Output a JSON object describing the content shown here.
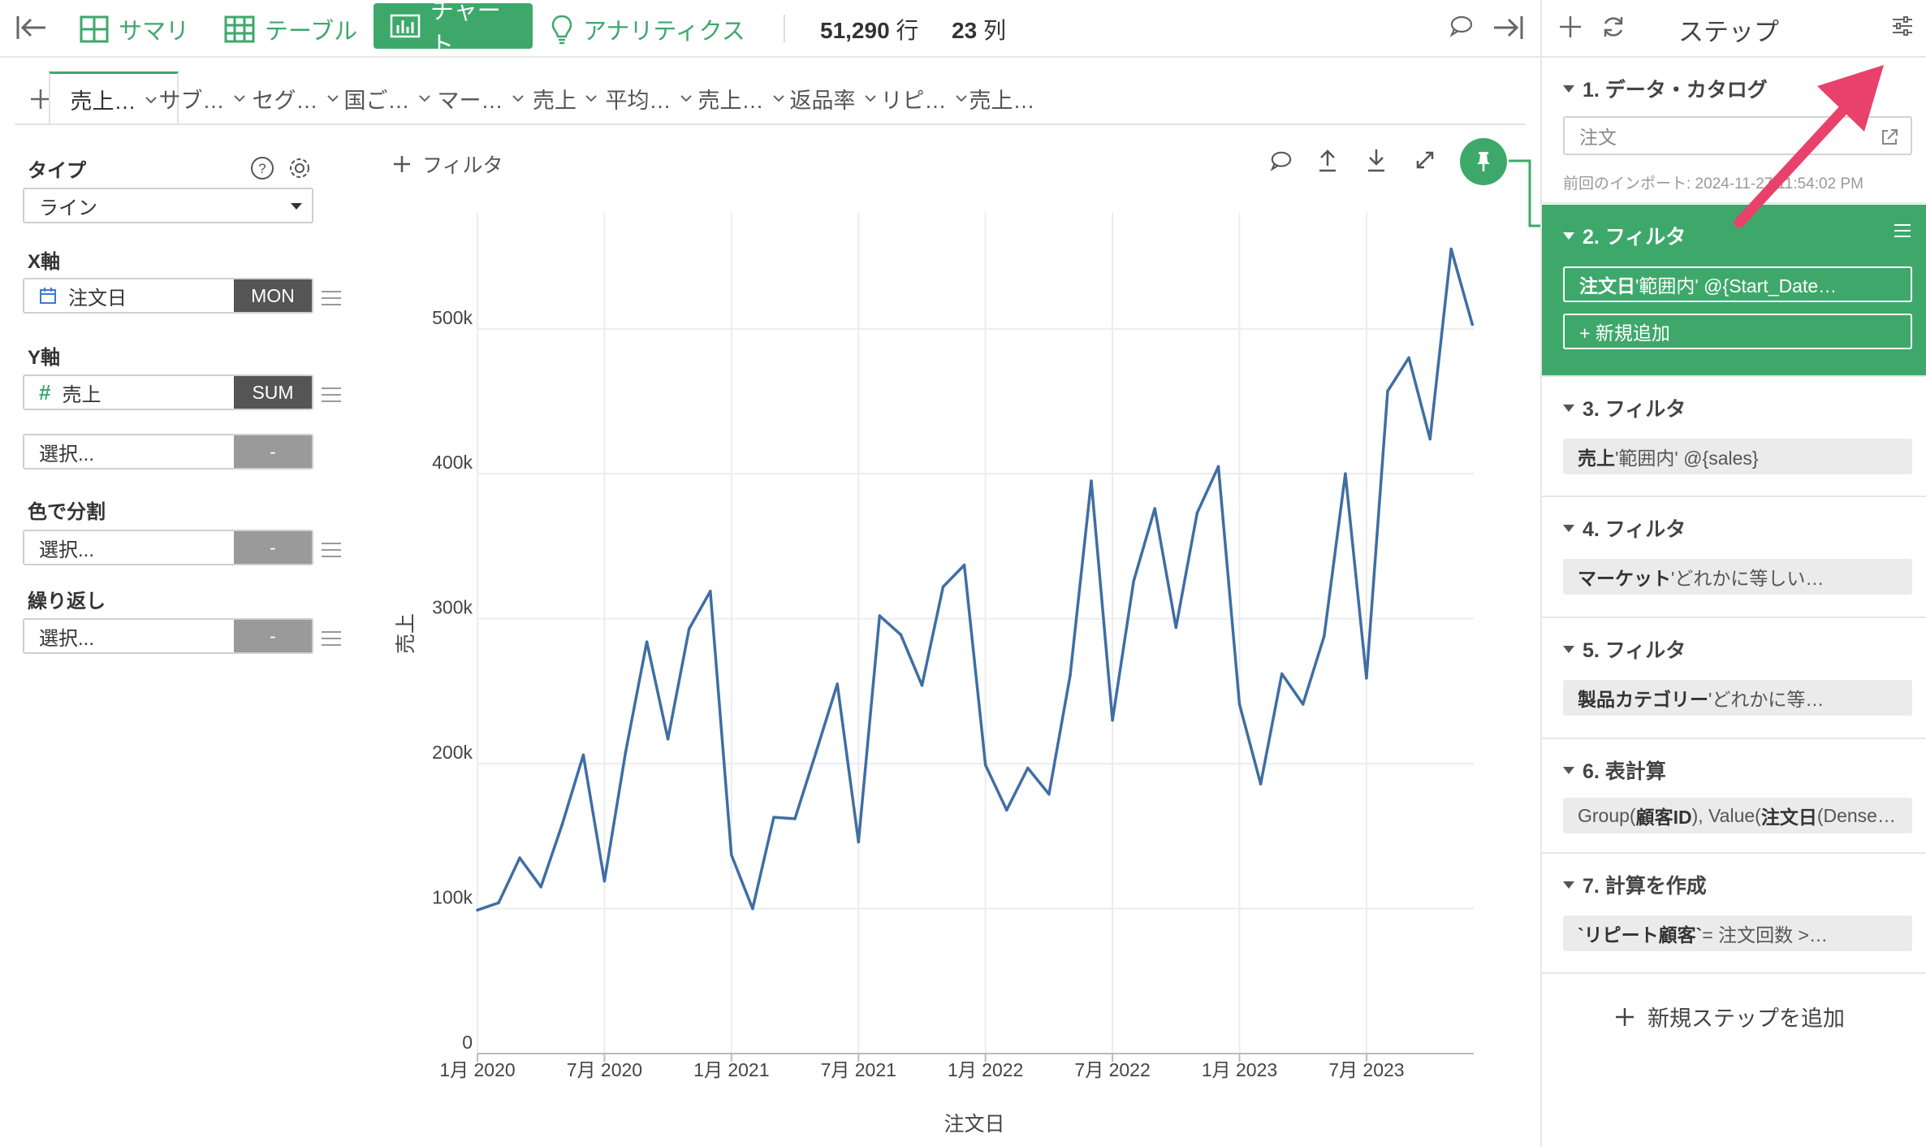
{
  "toolbar": {
    "summary": "サマリ",
    "table": "テーブル",
    "chart": "チャート",
    "analytics": "アナリティクス",
    "rows_value": "51,290",
    "rows_unit": "行",
    "cols_value": "23",
    "cols_unit": "列"
  },
  "tabs": [
    "売上…",
    "サブ…",
    "セグ…",
    "国ご…",
    "マー…",
    "売上",
    "平均…",
    "売上…",
    "返品率",
    "リピ…",
    "売上…"
  ],
  "config": {
    "type_label": "タイプ",
    "type_value": "ライン",
    "x_label": "X軸",
    "x_field": "注文日",
    "x_agg": "MON",
    "y_label": "Y軸",
    "y_field": "売上",
    "y_agg": "SUM",
    "y2_placeholder": "選択...",
    "empty_agg": "-",
    "color_label": "色で分割",
    "color_placeholder": "選択...",
    "repeat_label": "繰り返し",
    "repeat_placeholder": "選択..."
  },
  "chart_toolbar": {
    "filter_label": "フィルタ"
  },
  "chart_data": {
    "type": "line",
    "xlabel": "注文日",
    "ylabel": "売上",
    "ylim": [
      0,
      580000
    ],
    "y_ticks": [
      "0",
      "100k",
      "200k",
      "300k",
      "400k",
      "500k"
    ],
    "y_tick_values": [
      0,
      100000,
      200000,
      300000,
      400000,
      500000
    ],
    "x_ticks": [
      "1月 2020",
      "7月 2020",
      "1月 2021",
      "7月 2021",
      "1月 2022",
      "7月 2022",
      "1月 2023",
      "7月 2023"
    ],
    "series": [
      {
        "color": "#3f6ea3",
        "x": [
          "2020-01",
          "2020-02",
          "2020-03",
          "2020-04",
          "2020-05",
          "2020-06",
          "2020-07",
          "2020-08",
          "2020-09",
          "2020-10",
          "2020-11",
          "2020-12",
          "2021-01",
          "2021-02",
          "2021-03",
          "2021-04",
          "2021-05",
          "2021-06",
          "2021-07",
          "2021-08",
          "2021-09",
          "2021-10",
          "2021-11",
          "2021-12",
          "2022-01",
          "2022-02",
          "2022-03",
          "2022-04",
          "2022-05",
          "2022-06",
          "2022-07",
          "2022-08",
          "2022-09",
          "2022-10",
          "2022-11",
          "2022-12",
          "2023-01",
          "2023-02",
          "2023-03",
          "2023-04",
          "2023-05",
          "2023-06",
          "2023-07",
          "2023-08",
          "2023-09",
          "2023-10",
          "2023-11",
          "2023-12"
        ],
        "values": [
          99000,
          104000,
          135000,
          115000,
          158000,
          206000,
          119000,
          208000,
          284000,
          217000,
          293000,
          319000,
          137000,
          100000,
          163000,
          162000,
          208000,
          255000,
          146000,
          302000,
          289000,
          254000,
          322000,
          337000,
          199000,
          168000,
          197000,
          179000,
          261000,
          395000,
          230000,
          326000,
          376000,
          294000,
          373000,
          405000,
          241000,
          186000,
          262000,
          241000,
          288000,
          400000,
          259000,
          457000,
          480000,
          424000,
          555000,
          503000
        ]
      }
    ]
  },
  "steps": {
    "header_title": "ステップ",
    "items": [
      {
        "title": "1. データ・カタログ",
        "input_value": "注文",
        "note": "前回のインポート: 2024-11-27 11:54:02 PM"
      },
      {
        "title": "2. フィルタ",
        "chip_bold": "注文日",
        "chip_rest": " '範囲内' @{Start_Date…",
        "add_label": "+ 新規追加"
      },
      {
        "title": "3. フィルタ",
        "chip_bold": "売上",
        "chip_rest": " '範囲内' @{sales}"
      },
      {
        "title": "4. フィルタ",
        "chip_bold": "マーケット",
        "chip_rest": " 'どれかに等しい…"
      },
      {
        "title": "5. フィルタ",
        "chip_bold": "製品カテゴリー",
        "chip_rest": " 'どれかに等…"
      },
      {
        "title": "6. 表計算",
        "chip_pre": "Group(",
        "chip_bold": "顧客ID",
        "chip_mid": "), Value(",
        "chip_bold2": "注文日",
        "chip_rest": " (Dense…"
      },
      {
        "title": "7. 計算を作成",
        "chip_bold": "`リピート顧客`",
        "chip_rest": " = 注文回数 >…"
      }
    ],
    "add_step_label": "新規ステップを追加"
  },
  "colors": {
    "accent_green": "#3ea86b",
    "line_blue": "#3f6ea3",
    "arrow_pink": "#e8416b"
  }
}
